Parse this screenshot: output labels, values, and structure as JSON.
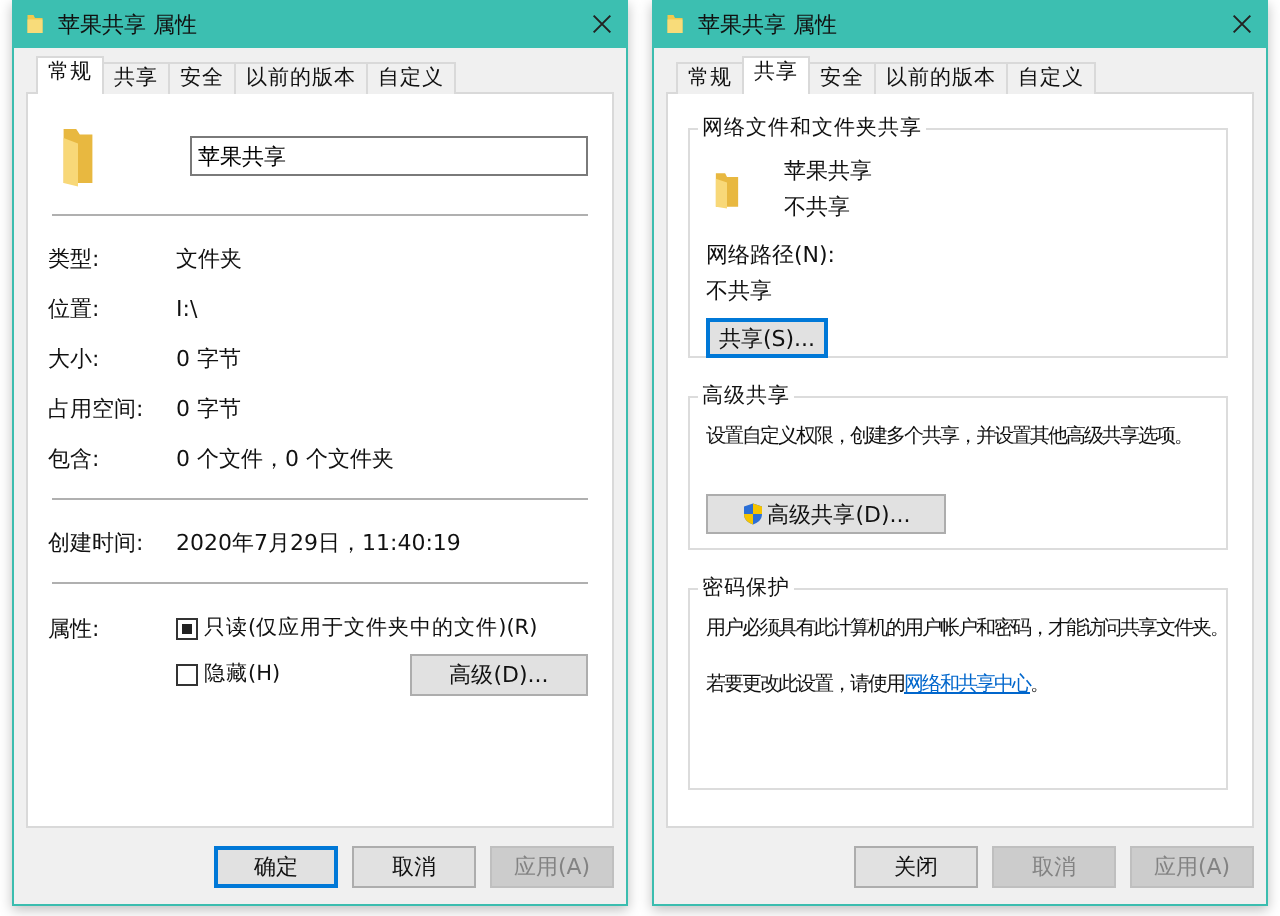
{
  "dialogs": [
    {
      "title": "苹果共享 属性",
      "tabs": [
        {
          "label": "常规",
          "selected": true
        },
        {
          "label": "共享",
          "selected": false
        },
        {
          "label": "安全",
          "selected": false
        },
        {
          "label": "以前的版本",
          "selected": false
        },
        {
          "label": "自定义",
          "selected": false
        }
      ],
      "page": {
        "kind": "general",
        "name_value": "苹果共享",
        "groups": [
          [
            {
              "label": "类型:",
              "value": "文件夹"
            },
            {
              "label": "位置:",
              "value": "I:\\"
            },
            {
              "label": "大小:",
              "value": "0 字节"
            },
            {
              "label": "占用空间:",
              "value": "0 字节"
            },
            {
              "label": "包含:",
              "value": "0 个文件，0 个文件夹"
            }
          ],
          [
            {
              "label": "创建时间:",
              "value": "2020年7月29日，11:40:19"
            }
          ]
        ],
        "attributes_label": "属性:",
        "checkboxes": [
          {
            "label": "只读(仅应用于文件夹中的文件)(R)",
            "checked": true
          },
          {
            "label": "隐藏(H)",
            "checked": false
          }
        ],
        "advanced_button": "高级(D)..."
      },
      "buttons": [
        {
          "label": "确定",
          "disabled": false,
          "default": true
        },
        {
          "label": "取消",
          "disabled": false,
          "default": false
        },
        {
          "label": "应用(A)",
          "disabled": true,
          "default": false
        }
      ]
    },
    {
      "title": "苹果共享 属性",
      "tabs": [
        {
          "label": "常规",
          "selected": false
        },
        {
          "label": "共享",
          "selected": true
        },
        {
          "label": "安全",
          "selected": false
        },
        {
          "label": "以前的版本",
          "selected": false
        },
        {
          "label": "自定义",
          "selected": false
        }
      ],
      "page": {
        "kind": "sharing",
        "status_group": {
          "legend": "网络文件和文件夹共享",
          "name": "苹果共享",
          "status": "不共享",
          "path_label": "网络路径(N):",
          "path_value": "不共享",
          "button": "共享(S)..."
        },
        "advanced_group": {
          "legend": "高级共享",
          "text": "设置自定义权限，创建多个共享，并设置其他高级共享选项。",
          "button": "高级共享(D)..."
        },
        "password_group": {
          "legend": "密码保护",
          "text": "用户必须具有此计算机的用户帐户和密码，才能访问共享文件夹。",
          "link_before": "若要更改此设置，请使用",
          "link": "网络和共享中心",
          "link_after": "。"
        }
      },
      "buttons": [
        {
          "label": "关闭",
          "disabled": false,
          "default": false
        },
        {
          "label": "取消",
          "disabled": true,
          "default": false
        },
        {
          "label": "应用(A)",
          "disabled": true,
          "default": false
        }
      ]
    }
  ]
}
